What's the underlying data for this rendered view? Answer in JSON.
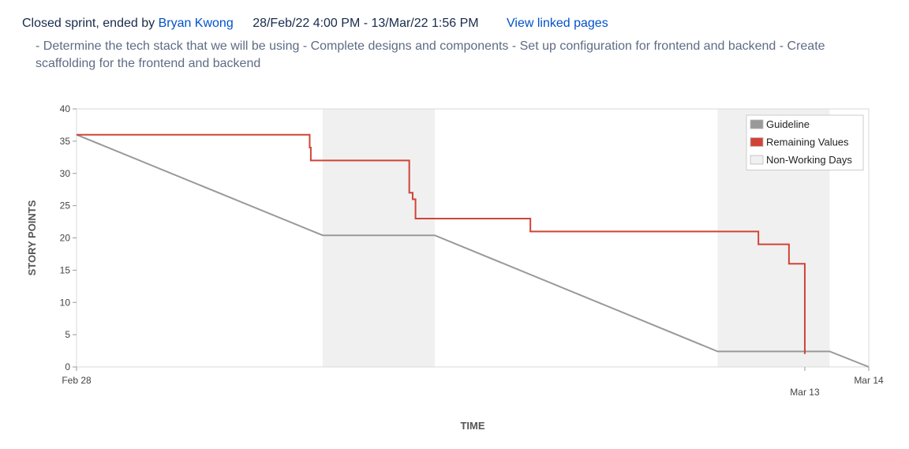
{
  "sprint": {
    "status_text": "Closed sprint, ended by",
    "ended_by": "Bryan Kwong",
    "date_range": "28/Feb/22 4:00 PM - 13/Mar/22 1:56 PM",
    "linked_pages": "View linked pages",
    "goal": "- Determine the tech stack that we will be using - Complete designs and components - Set up configuration for frontend and backend - Create scaffolding for the frontend and backend"
  },
  "chart_data": {
    "type": "line",
    "xlabel": "TIME",
    "ylabel": "STORY POINTS",
    "x_unit": "days since Feb 28",
    "xlim": [
      0,
      14
    ],
    "ylim": [
      0,
      40
    ],
    "y_ticks": [
      0,
      5,
      10,
      15,
      20,
      25,
      30,
      35,
      40
    ],
    "x_ticks": [
      {
        "x": 0,
        "label": "Feb 28",
        "row": 0
      },
      {
        "x": 12.87,
        "label": "Mar 13",
        "row": 1
      },
      {
        "x": 14,
        "label": "Mar 14",
        "row": 0
      }
    ],
    "legend": [
      {
        "label": "Guideline",
        "color": "#999999"
      },
      {
        "label": "Remaining Values",
        "color": "#d04437"
      },
      {
        "label": "Non-Working Days",
        "color": "#f0f0f0"
      }
    ],
    "non_working_days": [
      [
        4.35,
        6.33
      ],
      [
        11.33,
        13.31
      ]
    ],
    "series": [
      {
        "name": "Guideline",
        "color": "#999999",
        "points": [
          [
            0,
            36
          ],
          [
            4.35,
            20.4
          ],
          [
            6.33,
            20.4
          ],
          [
            11.33,
            2.4
          ],
          [
            13.31,
            2.4
          ],
          [
            14,
            0
          ]
        ]
      },
      {
        "name": "Remaining Values",
        "color": "#d04437",
        "step": true,
        "points": [
          [
            0,
            36
          ],
          [
            4.1,
            36
          ],
          [
            4.12,
            34
          ],
          [
            4.14,
            32
          ],
          [
            5.83,
            32
          ],
          [
            5.88,
            27
          ],
          [
            5.94,
            26
          ],
          [
            5.99,
            23
          ],
          [
            8.0,
            23
          ],
          [
            8.02,
            21
          ],
          [
            12.03,
            21
          ],
          [
            12.05,
            19
          ],
          [
            12.57,
            19
          ],
          [
            12.59,
            16
          ],
          [
            12.85,
            16
          ],
          [
            12.87,
            2
          ]
        ]
      }
    ]
  }
}
